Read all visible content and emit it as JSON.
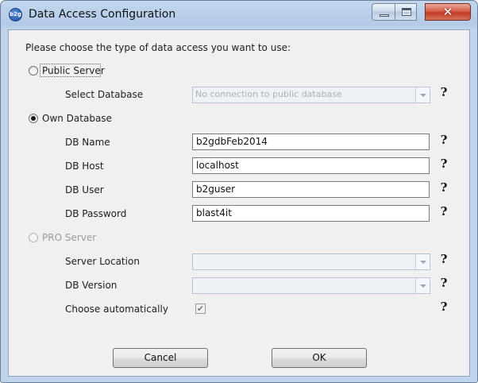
{
  "window": {
    "title": "Data Access Configuration",
    "app_icon_text": "b2g",
    "close_glyph": "✕"
  },
  "prompt": "Please choose the type of data access you want to use:",
  "public_server": {
    "label": "Public Server",
    "selected": false,
    "select_database_label": "Select Database",
    "select_database_value": "No connection to public database"
  },
  "own_database": {
    "label": "Own Database",
    "selected": true,
    "fields": [
      {
        "label": "DB Name",
        "value": "b2gdbFeb2014"
      },
      {
        "label": "DB Host",
        "value": "localhost"
      },
      {
        "label": "DB User",
        "value": "b2guser"
      },
      {
        "label": "DB Password",
        "value": "blast4it"
      }
    ]
  },
  "pro_server": {
    "label": "PRO Server",
    "selected": false,
    "enabled": false,
    "server_location_label": "Server Location",
    "server_location_value": "",
    "db_version_label": "DB Version",
    "db_version_value": "",
    "choose_automatically_label": "Choose automatically",
    "choose_automatically_checked": true
  },
  "help_glyph": "?",
  "buttons": {
    "cancel": "Cancel",
    "ok": "OK"
  }
}
